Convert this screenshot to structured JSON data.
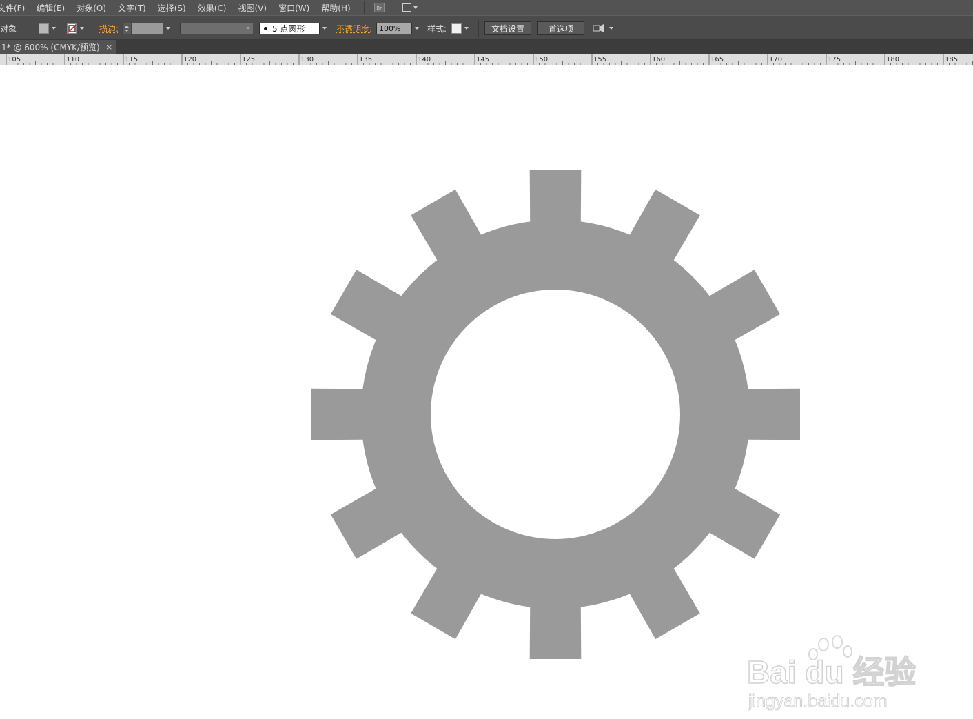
{
  "menu": {
    "items": [
      "文件(F)",
      "编辑(E)",
      "对象(O)",
      "文字(T)",
      "选择(S)",
      "效果(C)",
      "视图(V)",
      "窗口(W)",
      "帮助(H)"
    ],
    "bridge_label": "Br"
  },
  "control_bar": {
    "selection_label": "对象",
    "stroke_label": "描边:",
    "brush_value": "5 点圆形",
    "opacity_label": "不透明度:",
    "opacity_value": "100%",
    "style_label": "样式:",
    "doc_setup_label": "文档设置",
    "preferences_label": "首选项"
  },
  "tab": {
    "title": "1* @ 600% (CMYK/预览)",
    "close_glyph": "×"
  },
  "ruler": {
    "labels": [
      "105",
      "110",
      "115",
      "120",
      "125",
      "130",
      "135",
      "140",
      "145",
      "150",
      "155",
      "160",
      "165",
      "170",
      "175",
      "180",
      "185"
    ]
  },
  "canvas": {
    "gear": {
      "teeth": 12,
      "fill": "#9b9a9b"
    }
  },
  "watermark": {
    "brand": "Bai du 经验",
    "url": "jingyan.baidu.com"
  },
  "colors": {
    "menubar": "#535353",
    "controlbar": "#4b4b4b",
    "accent_label": "#f3a02e",
    "gear_fill": "#9b9a9b"
  }
}
